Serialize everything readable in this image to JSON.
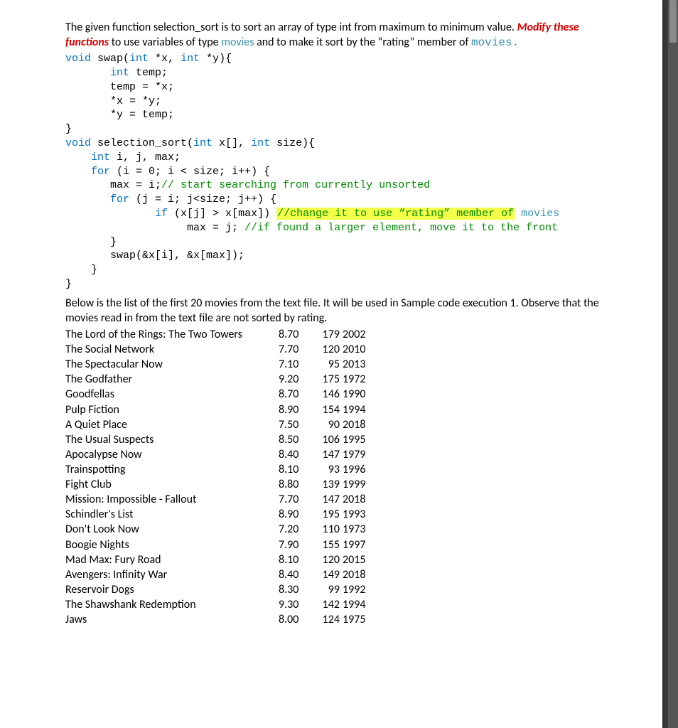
{
  "intro": {
    "part1": "The given function selection_sort is to sort an array of type int from maximum to minimum value. ",
    "modify": "Modify these functions",
    "part2": " to use variables of type ",
    "movies_word": "movies",
    "part3": " and to make it sort by the “rating” member of ",
    "movies_word2": "movies",
    "period": "."
  },
  "code": {
    "swap": {
      "sig_void": "void",
      "sig_name": " swap(",
      "sig_int1": "int",
      "sig_mid": " *x, ",
      "sig_int2": "int",
      "sig_end": " *y){",
      "l2_kw": "int",
      "l2_rest": " temp;",
      "l3": "temp = *x;",
      "l4": "*x = *y;",
      "l5": "*y = temp;",
      "close": "}"
    },
    "sort": {
      "sig_void": "void",
      "sig_name": " selection_sort(",
      "sig_int": "int",
      "sig_mid": " x[], ",
      "sig_int2": "int",
      "sig_end": " size){",
      "decl_kw": "int",
      "decl_rest": " i, j, max;",
      "for1_kw": "for",
      "for1_body": " (i = 0; i < size; i++) {",
      "max_line": "max = i;",
      "max_cmt": "// start searching from currently unsorted",
      "for2_kw": "for",
      "for2_body": " (j = i; j<size; j++) {",
      "if_kw": "if",
      "if_cond": " (x[j] > x[max]) ",
      "if_hl_cmt": "//change it to use “rating” member of",
      "if_hl_movies": " movies",
      "maxj": "max = j; ",
      "maxj_cmt": "//if found a larger element, move it to the front",
      "close_inner": "}",
      "swap_call": "swap(&x[i], &x[max]);",
      "close_for": "}",
      "close_fn": "}"
    }
  },
  "below_para": "Below is the list of the first 20 movies from the text file. It will be used in Sample code execution 1. Observe that the movies read in from the text file are not sorted by rating.",
  "movies": [
    {
      "title": "The Lord of the Rings: The Two Towers",
      "rating": "8.70",
      "runtime": "179",
      "year": "2002"
    },
    {
      "title": "The Social Network",
      "rating": "7.70",
      "runtime": "120",
      "year": "2010"
    },
    {
      "title": "The Spectacular Now",
      "rating": "7.10",
      "runtime": "95",
      "year": "2013"
    },
    {
      "title": "The Godfather",
      "rating": "9.20",
      "runtime": "175",
      "year": "1972"
    },
    {
      "title": "Goodfellas",
      "rating": "8.70",
      "runtime": "146",
      "year": "1990"
    },
    {
      "title": "Pulp Fiction",
      "rating": "8.90",
      "runtime": "154",
      "year": "1994"
    },
    {
      "title": "A Quiet Place",
      "rating": "7.50",
      "runtime": "90",
      "year": "2018"
    },
    {
      "title": "The Usual Suspects",
      "rating": "8.50",
      "runtime": "106",
      "year": "1995"
    },
    {
      "title": "Apocalypse Now",
      "rating": "8.40",
      "runtime": "147",
      "year": "1979"
    },
    {
      "title": "Trainspotting",
      "rating": "8.10",
      "runtime": "93",
      "year": "1996"
    },
    {
      "title": "Fight Club",
      "rating": "8.80",
      "runtime": "139",
      "year": "1999"
    },
    {
      "title": "Mission: Impossible - Fallout",
      "rating": "7.70",
      "runtime": "147",
      "year": "2018"
    },
    {
      "title": "Schindler's List",
      "rating": "8.90",
      "runtime": "195",
      "year": "1993"
    },
    {
      "title": "Don't Look Now",
      "rating": "7.20",
      "runtime": "110",
      "year": "1973"
    },
    {
      "title": "Boogie Nights",
      "rating": "7.90",
      "runtime": "155",
      "year": "1997"
    },
    {
      "title": "Mad Max: Fury Road",
      "rating": "8.10",
      "runtime": "120",
      "year": "2015"
    },
    {
      "title": "Avengers: Infinity War",
      "rating": "8.40",
      "runtime": "149",
      "year": "2018"
    },
    {
      "title": "Reservoir Dogs",
      "rating": "8.30",
      "runtime": "99",
      "year": "1992"
    },
    {
      "title": "The Shawshank Redemption",
      "rating": "9.30",
      "runtime": "142",
      "year": "1994"
    },
    {
      "title": "Jaws",
      "rating": "8.00",
      "runtime": "124",
      "year": "1975"
    }
  ]
}
